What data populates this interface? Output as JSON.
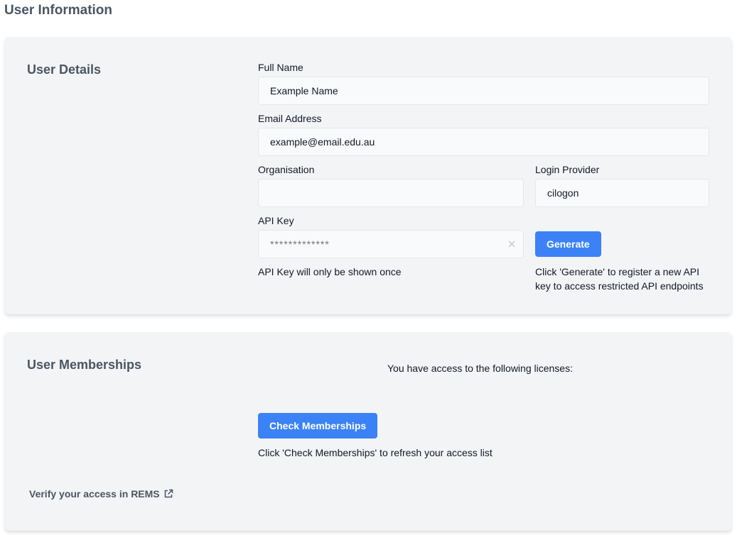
{
  "page": {
    "title": "User Information"
  },
  "details": {
    "section_title": "User Details",
    "full_name": {
      "label": "Full Name",
      "value": "Example Name"
    },
    "email": {
      "label": "Email Address",
      "value": "example@email.edu.au"
    },
    "organisation": {
      "label": "Organisation",
      "value": ""
    },
    "login_provider": {
      "label": "Login Provider",
      "value": "cilogon"
    },
    "api_key": {
      "label": "API Key",
      "placeholder": "*************",
      "helper": "API Key will only be shown once",
      "clear_icon": "close-x-icon"
    },
    "generate": {
      "label": "Generate",
      "helper": "Click 'Generate' to register a new API key to access restricted API endpoints"
    }
  },
  "memberships": {
    "section_title": "User Memberships",
    "access_text": "You have access to the following licenses:",
    "check_button": "Check Memberships",
    "helper": "Click 'Check Memberships' to refresh your access list",
    "rems_link": "Verify your access in REMS",
    "rems_icon": "external-link-icon"
  },
  "colors": {
    "primary": "#3b82f6",
    "card_bg": "#f3f4f6",
    "field_bg": "#f9fafb",
    "heading": "#4b5563"
  }
}
